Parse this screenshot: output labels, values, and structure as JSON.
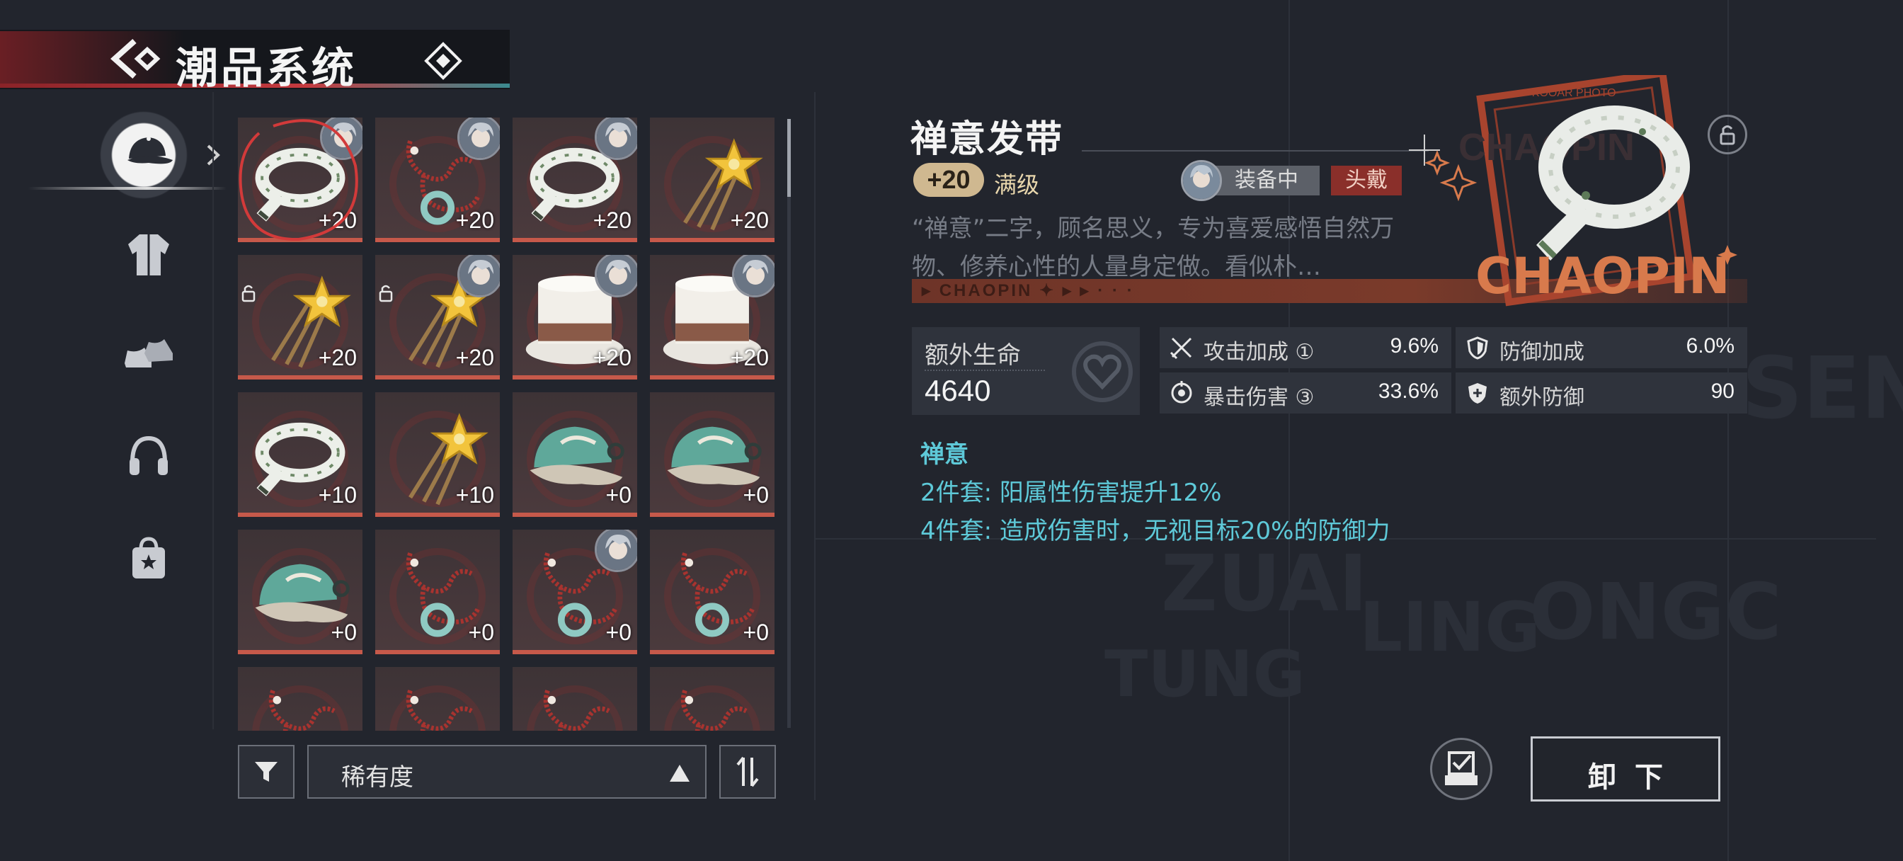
{
  "header": {
    "title": "潮品系统"
  },
  "categories": [
    {
      "icon": "cap-icon",
      "active": true
    },
    {
      "icon": "jacket-icon",
      "active": false
    },
    {
      "icon": "sneakers-icon",
      "active": false
    },
    {
      "icon": "headphones-icon",
      "active": false
    },
    {
      "icon": "bag-icon",
      "active": false
    }
  ],
  "grid": {
    "items": [
      {
        "type": "ribbon",
        "level": "+20",
        "avatar": true,
        "selected": true,
        "locked": false
      },
      {
        "type": "cord",
        "level": "+20",
        "avatar": true,
        "selected": false,
        "locked": false
      },
      {
        "type": "ribbon",
        "level": "+20",
        "avatar": true,
        "selected": false,
        "locked": false
      },
      {
        "type": "hairpin",
        "level": "+20",
        "avatar": false,
        "selected": false,
        "locked": false
      },
      {
        "type": "hairpin",
        "level": "+20",
        "avatar": false,
        "selected": false,
        "locked": true
      },
      {
        "type": "hairpin",
        "level": "+20",
        "avatar": true,
        "selected": false,
        "locked": true
      },
      {
        "type": "tophat",
        "level": "+20",
        "avatar": true,
        "selected": false,
        "locked": false
      },
      {
        "type": "tophat",
        "level": "+20",
        "avatar": true,
        "selected": false,
        "locked": false
      },
      {
        "type": "ribbon",
        "level": "+10",
        "avatar": false,
        "selected": false,
        "locked": false
      },
      {
        "type": "hairpin",
        "level": "+10",
        "avatar": false,
        "selected": false,
        "locked": false
      },
      {
        "type": "cap",
        "level": "+0",
        "avatar": false,
        "selected": false,
        "locked": false
      },
      {
        "type": "cap",
        "level": "+0",
        "avatar": false,
        "selected": false,
        "locked": false
      },
      {
        "type": "cap",
        "level": "+0",
        "avatar": false,
        "selected": false,
        "locked": false
      },
      {
        "type": "cord",
        "level": "+0",
        "avatar": false,
        "selected": false,
        "locked": false
      },
      {
        "type": "cord",
        "level": "+0",
        "avatar": true,
        "selected": false,
        "locked": false
      },
      {
        "type": "cord",
        "level": "+0",
        "avatar": false,
        "selected": false,
        "locked": false
      },
      {
        "type": "cord",
        "level": "",
        "avatar": false,
        "selected": false,
        "locked": false
      },
      {
        "type": "cord",
        "level": "",
        "avatar": false,
        "selected": false,
        "locked": false
      },
      {
        "type": "cord",
        "level": "",
        "avatar": false,
        "selected": false,
        "locked": false
      },
      {
        "type": "cord",
        "level": "",
        "avatar": false,
        "selected": false,
        "locked": false
      }
    ]
  },
  "controls": {
    "sort_label": "稀有度"
  },
  "detail": {
    "name": "禅意发带",
    "level": "+20",
    "max_label": "满级",
    "equipped_label": "装备中",
    "slot_label": "头戴",
    "description": "“禅意”二字，顾名思义，专为喜爱感悟自然万物、修养心性的人量身定做。看似朴…",
    "banner_text": "▸ CHAOPIN ✦ ▸ ▸ · · ·",
    "art_brand": "CHAOPIN",
    "art_stamp": "× KOOAR PHOTO",
    "main_stat": {
      "label": "额外生命",
      "value": "4640"
    },
    "stats": [
      {
        "icon": "crossed-swords-icon",
        "label": "攻击加成 ①",
        "value": "9.6%"
      },
      {
        "icon": "shield-icon",
        "label": "防御加成",
        "value": "6.0%"
      },
      {
        "icon": "crit-target-icon",
        "label": "暴击伤害 ③",
        "value": "33.6%"
      },
      {
        "icon": "shield-plus-icon",
        "label": "额外防御",
        "value": "90"
      }
    ],
    "set_name": "禅意",
    "set_effects": [
      "2件套: 阳属性伤害提升12%",
      "4件套: 造成伤害时，无视目标20%的防御力"
    ],
    "unequip_label": "卸下"
  },
  "colors": {
    "accent_cyan": "#5ec9d8",
    "rarity_orange": "#c6594a",
    "level_badge": "#cfb890",
    "slot_tag": "#8a2f2a"
  }
}
